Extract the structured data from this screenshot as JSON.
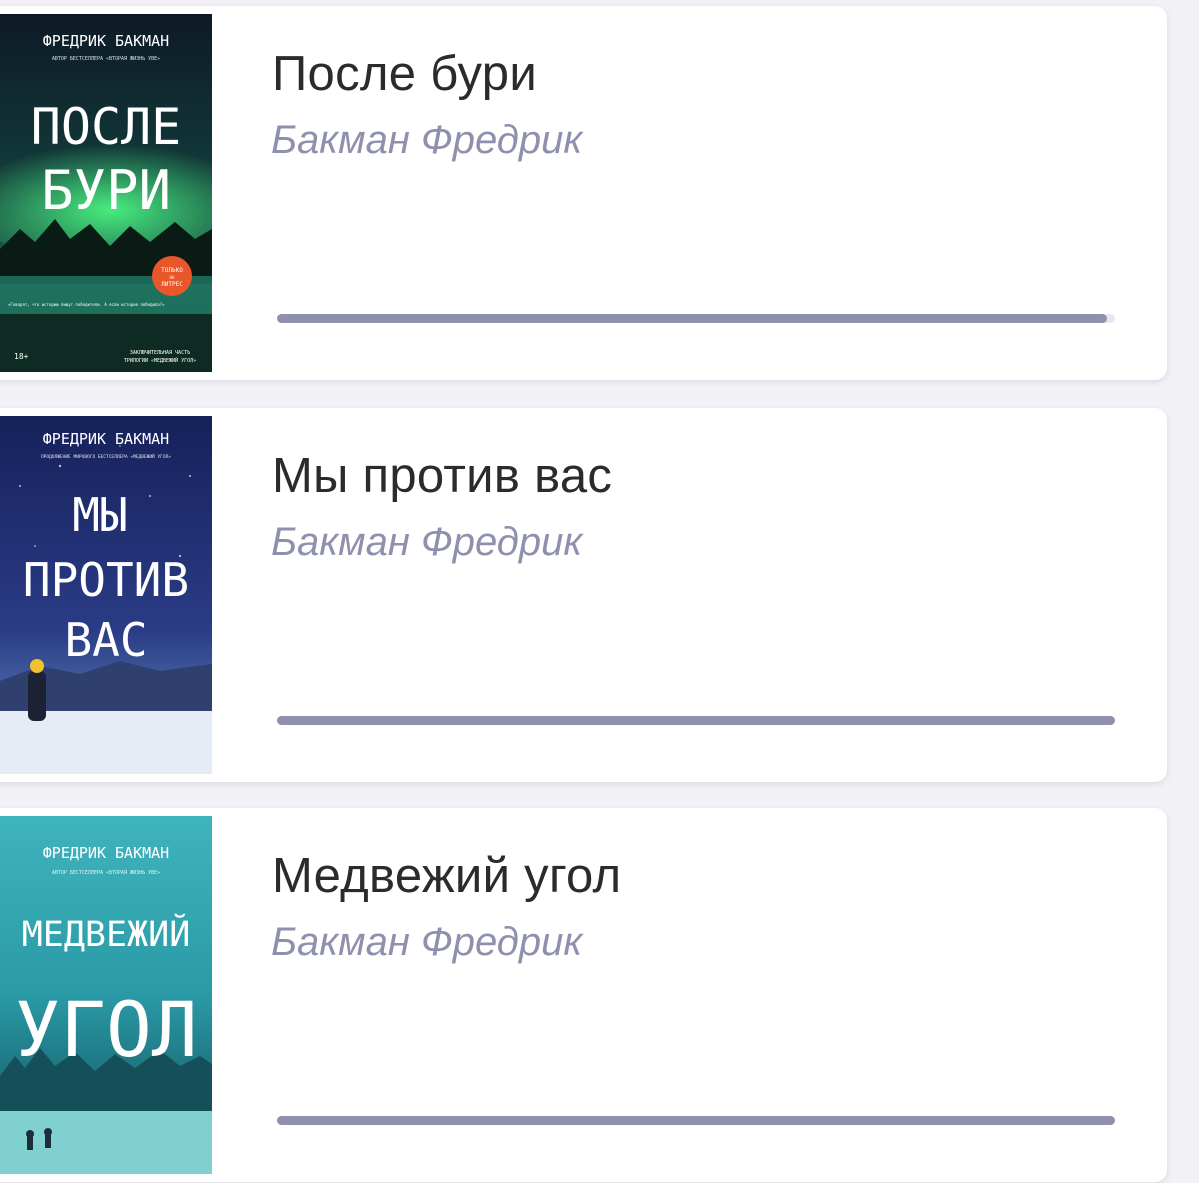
{
  "books": [
    {
      "title": "После бури",
      "author": "Бакман Фредрик",
      "progress": 0.99,
      "cover": {
        "author": "ФРЕДРИК БАКМАН",
        "tagline": "АВТОР БЕСТСЕЛЛЕРА «ВТОРАЯ ЖИЗНЬ УВЕ»",
        "title_lines": [
          "ПОСЛЕ",
          "БУРИ"
        ],
        "badge_top": "ТОЛЬКО",
        "badge_mid": "НА",
        "badge_bottom": "ЛИТРЕС",
        "quote": "«Говорят, что историю пишут победители. А если история победила?»",
        "age": "18+",
        "footer_1": "ЗАКЛЮЧИТЕЛЬНАЯ ЧАСТЬ",
        "footer_2": "ТРИЛОГИИ «МЕДВЕЖИЙ УГОЛ»",
        "colors": {
          "sky": "#0f2230",
          "aurora": "#2fd36b",
          "water": "#1b6b5a",
          "badge": "#e8562a"
        }
      }
    },
    {
      "title": "Мы против вас",
      "author": "Бакман Фредрик",
      "progress": 1.0,
      "cover": {
        "author": "ФРЕДРИК БАКМАН",
        "tagline": "ПРОДОЛЖЕНИЕ МИРОВОГО БЕСТСЕЛЛЕРА «МЕДВЕЖИЙ УГОЛ»",
        "title_lines": [
          "МЫ",
          "ПРОТИВ",
          "ВАС"
        ],
        "colors": {
          "sky": "#1a2a66",
          "snow": "#dfe6f2",
          "hat": "#f2c12e"
        }
      }
    },
    {
      "title": "Медвежий угол",
      "author": "Бакман Фредрик",
      "progress": 1.0,
      "cover": {
        "author": "ФРЕДРИК БАКМАН",
        "tagline": "АВТОР БЕСТСЕЛЛЕРА «ВТОРАЯ ЖИЗНЬ УВЕ»",
        "title_lines": [
          "МЕДВЕЖИЙ",
          "УГОЛ"
        ],
        "colors": {
          "sky": "#2aa3b0",
          "forest": "#1c6f7a",
          "ice": "#7fd0cf"
        }
      }
    }
  ]
}
